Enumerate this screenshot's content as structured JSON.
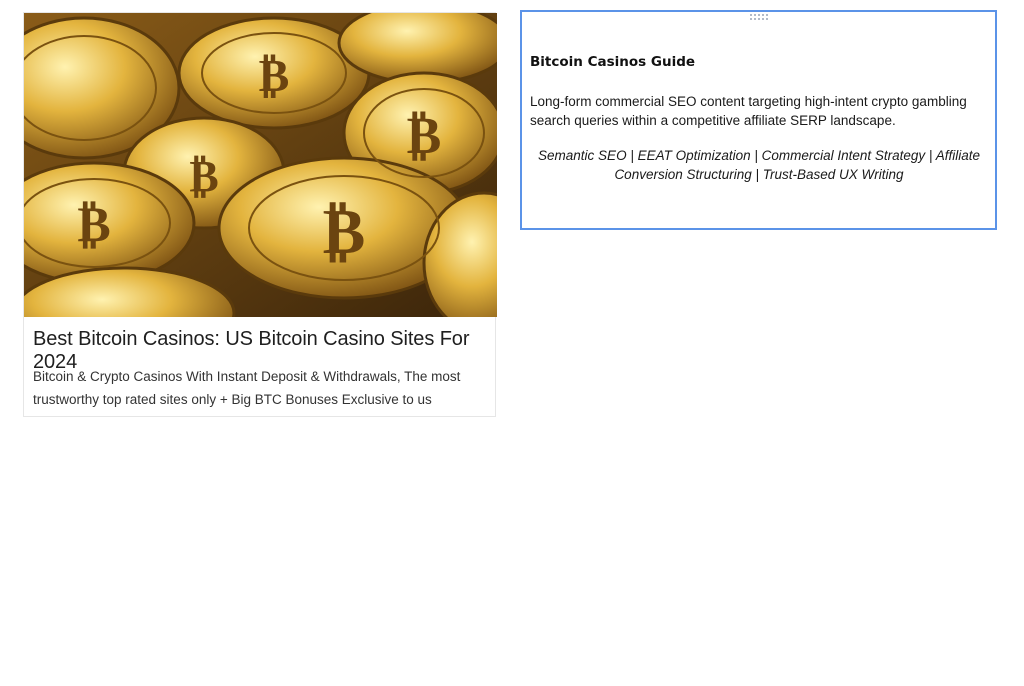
{
  "card": {
    "image_alt": "Pile of gold Bitcoin coins",
    "title": "Best Bitcoin Casinos: US Bitcoin Casino Sites For 2024",
    "description": "Bitcoin & Crypto Casinos With Instant Deposit & Withdrawals, The most trustworthy top rated sites only + Big BTC Bonuses Exclusive to us"
  },
  "panel": {
    "heading": "Bitcoin Casinos Guide",
    "body": "Long-form commercial SEO content targeting high-intent crypto gambling search queries within a competitive affiliate SERP landscape.",
    "tags": "Semantic SEO | EEAT Optimization | Commercial Intent Strategy | Affiliate Conversion Structuring | Trust-Based UX Writing"
  },
  "colors": {
    "panel_border": "#5b93e8",
    "coin_gold": "#d9a933",
    "coin_dark": "#6b4410"
  }
}
